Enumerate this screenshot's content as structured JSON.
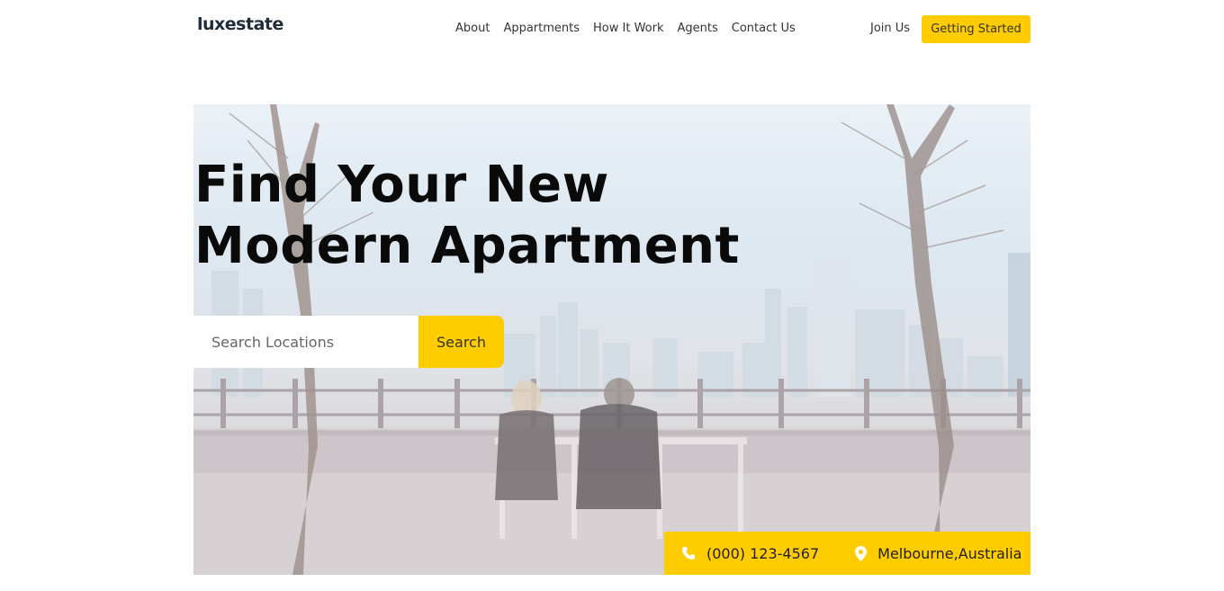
{
  "brand": {
    "name": "luxestate"
  },
  "nav": {
    "items": [
      {
        "label": "About"
      },
      {
        "label": "Appartments"
      },
      {
        "label": "How It Work"
      },
      {
        "label": "Agents"
      },
      {
        "label": "Contact Us"
      }
    ],
    "join_label": "Join Us",
    "cta_label": "Getting Started"
  },
  "hero": {
    "title_line1": "Find Your New",
    "title_line2": "Modern Apartment",
    "search": {
      "placeholder": "Search Locations",
      "value": "",
      "button_label": "Search"
    },
    "contact": {
      "phone": "(000) 123-4567",
      "location": "Melbourne,Australia",
      "phone_icon": "phone-icon",
      "location_icon": "map-pin-icon"
    }
  },
  "colors": {
    "accent": "#ffcc00",
    "text_dark": "#0a0a0a",
    "logo": "#1f2d3a"
  }
}
